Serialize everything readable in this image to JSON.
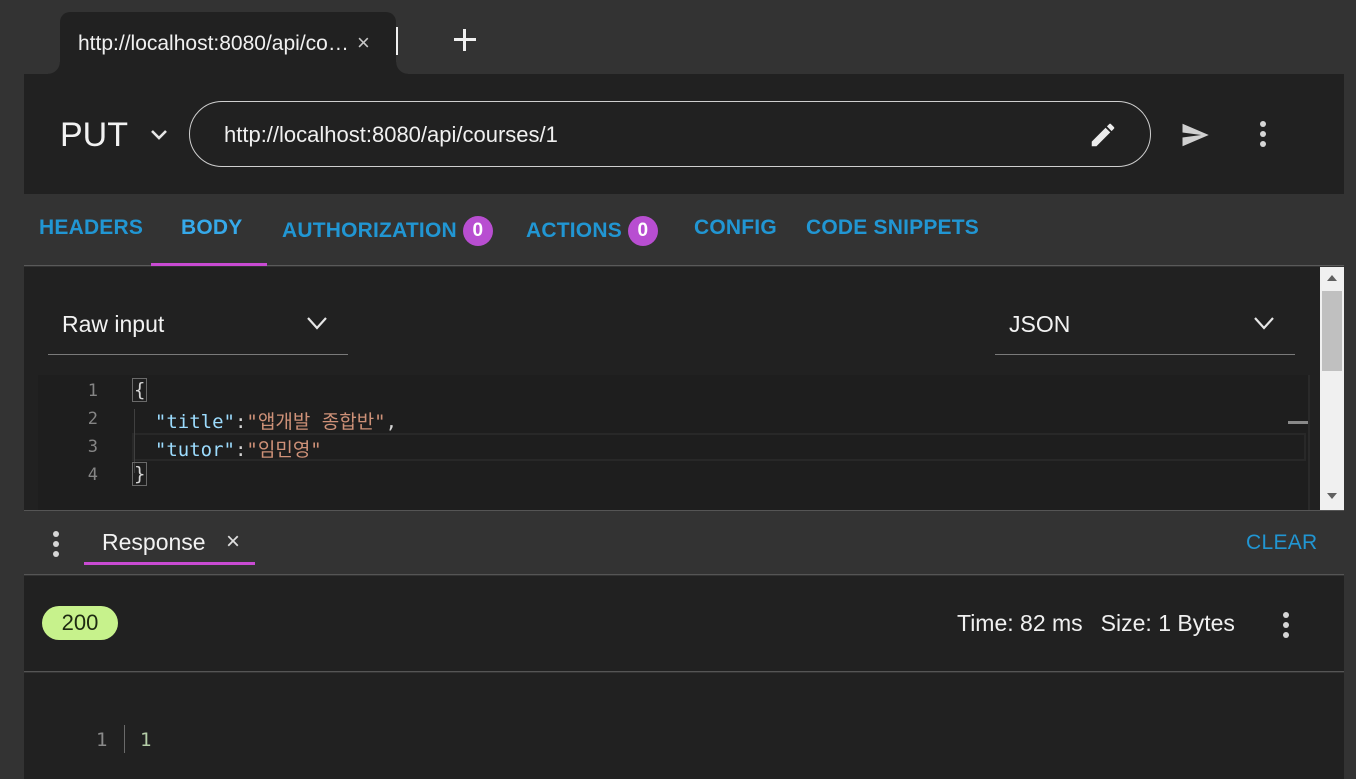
{
  "tab": {
    "title": "http://localhost:8080/api/courses/1",
    "close": "×"
  },
  "request": {
    "method": "PUT",
    "url": "http://localhost:8080/api/courses/1"
  },
  "tabs": [
    {
      "label": "HEADERS"
    },
    {
      "label": "BODY",
      "active": true
    },
    {
      "label": "AUTHORIZATION",
      "badge": "0"
    },
    {
      "label": "ACTIONS",
      "badge": "0"
    },
    {
      "label": "CONFIG"
    },
    {
      "label": "CODE SNIPPETS"
    }
  ],
  "body": {
    "input_mode": "Raw input",
    "content_type": "JSON",
    "line_numbers": [
      "1",
      "2",
      "3",
      "4"
    ],
    "lines": {
      "open": "{",
      "title_key": "\"title\"",
      "colon": ":",
      "title_value": "\"앱개발 종합반\"",
      "comma": ",",
      "tutor_key": "\"tutor\"",
      "tutor_value": "\"임민영\"",
      "close": "}"
    }
  },
  "response": {
    "tab_label": "Response",
    "close": "×",
    "clear_label": "CLEAR",
    "status": "200",
    "time": "Time: 82 ms",
    "size": "Size: 1 Bytes",
    "line_number": "1",
    "body": "1"
  },
  "colors": {
    "accent": "#2196d3",
    "tab_underline": "#c94bd3",
    "badge": "#b84ed1",
    "status_ok": "#c7f28c"
  },
  "icons": [
    "close-icon",
    "plus-icon",
    "chevron-down-icon",
    "pencil-icon",
    "send-icon",
    "more-vert-icon"
  ]
}
